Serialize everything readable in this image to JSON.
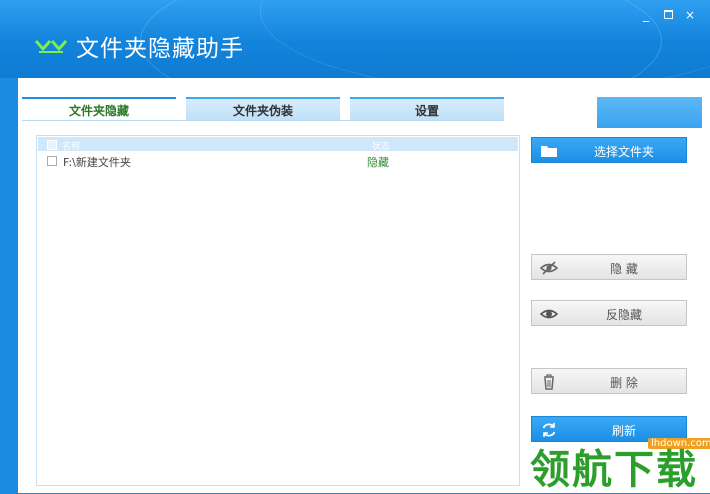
{
  "window": {
    "title": "文件夹隐藏助手",
    "minimize": "_",
    "close": "×"
  },
  "tabs": [
    {
      "label": "文件夹隐藏",
      "active": true
    },
    {
      "label": "文件夹伪装",
      "active": false
    },
    {
      "label": "设置",
      "active": false
    }
  ],
  "list": {
    "headers": {
      "name": "名称",
      "status": "状态"
    },
    "rows": [
      {
        "name": "F:\\新建文件夹",
        "status": "隐藏",
        "checked": false
      }
    ]
  },
  "buttons": {
    "select_folder": "选择文件夹",
    "hide": "隐 藏",
    "unhide": "反隐藏",
    "delete": "删 除",
    "refresh": "刷新"
  },
  "icons": {
    "logo": "logo-icon",
    "select_folder": "folder-icon",
    "hide": "eye-slash-icon",
    "unhide": "eye-icon",
    "delete": "trash-icon",
    "refresh": "refresh-icon"
  },
  "colors": {
    "titlebar": "#1283db",
    "accent_blue": "#1c8fe6",
    "status_green": "#2e8b2e"
  },
  "watermark": {
    "url": "lhdown.com",
    "text": "领航下载"
  }
}
